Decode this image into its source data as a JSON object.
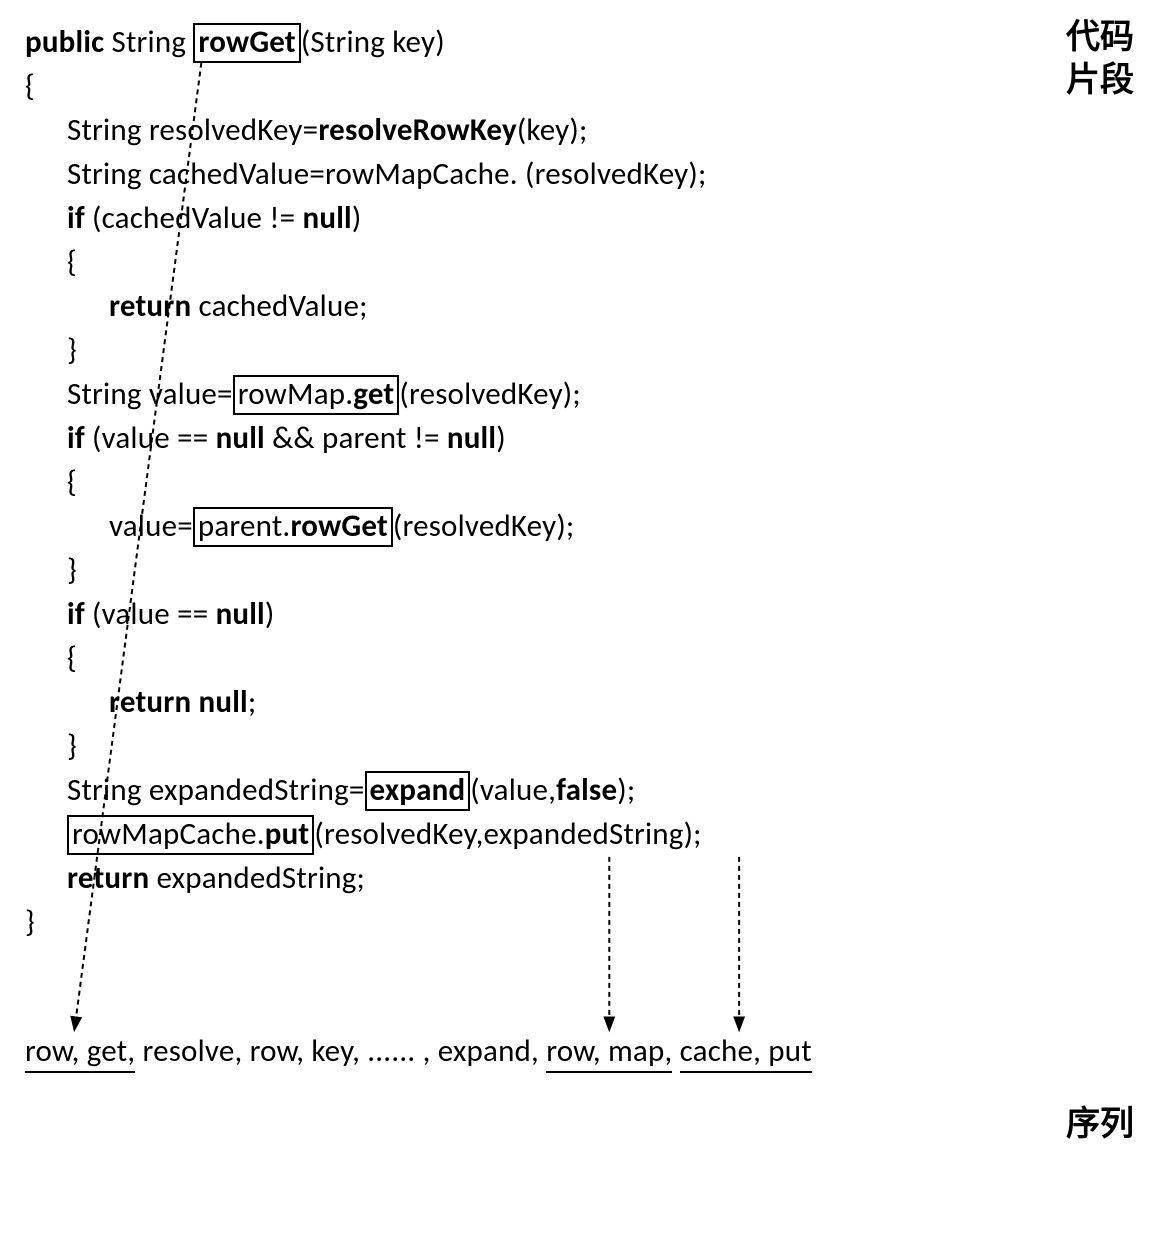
{
  "labels": {
    "code_snippet_line1": "代码",
    "code_snippet_line2": "片段",
    "sequence": "序列"
  },
  "code": {
    "l1_public": "public",
    "l1_string": " String",
    "l1_boxed": "rowGet",
    "l1_rest": "(String key)",
    "l2": "{",
    "l3a": "String resolvedKey=",
    "l3b_bold": "resolveRowKey",
    "l3c": "(key);",
    "l4": "String cachedValue=rowMapCache. (resolvedKey);",
    "l5_if": "if",
    "l5_rest_a": " (cachedValue != ",
    "l5_null": "null",
    "l5_rest_b": ")",
    "l6": "{",
    "l7_return": "return",
    "l7_rest": " cachedValue;",
    "l8": "}",
    "l9a": "String value=",
    "l9_boxed": "rowMap.get",
    "l9c": "(resolvedKey);",
    "l10_if": "if",
    "l10a": " (value == ",
    "l10_null1": "null",
    "l10b": " && parent != ",
    "l10_null2": "null",
    "l10c": ")",
    "l11": "{",
    "l12a": "value=",
    "l12_boxed": "parent.rowGet",
    "l12c": "(resolvedKey);",
    "l13": "}",
    "l14_if": "if",
    "l14a": " (value == ",
    "l14_null": "null",
    "l14b": ")",
    "l15": "{",
    "l16_return": "return",
    "l16_space": " ",
    "l16_null": "null",
    "l16_semi": ";",
    "l17": "}",
    "l18a": "String expandedString=",
    "l18_boxed": "expand",
    "l18c": "(value,",
    "l18_false": "false",
    "l18d": ");",
    "l19_boxed": "rowMapCache.put",
    "l19c": "(resolvedKey,expandedString);",
    "l20_return": "return",
    "l20_rest": " expandedString;",
    "l21": "}"
  },
  "sequence_tokens": {
    "seg1": "row, get,",
    "mid": " resolve, row, key, ...... , expand, ",
    "seg2": "row, map,",
    "gap": " ",
    "seg3": "cache, put"
  },
  "chart_data": {
    "type": "diagram",
    "title": "Code snippet to token sequence extraction",
    "boxed_identifiers": [
      "rowGet",
      "rowMap.get",
      "parent.rowGet",
      "expand",
      "rowMapCache.put"
    ],
    "output_sequence": [
      "row",
      "get",
      "resolve",
      "row",
      "key",
      "......",
      "expand",
      "row",
      "map",
      "cache",
      "put"
    ],
    "arrows": [
      {
        "from": "rowGet (method name)",
        "to": "row, get"
      },
      {
        "from": "expand / rowMapCache.put area",
        "to": "row, map"
      },
      {
        "from": "expand / rowMapCache.put area",
        "to": "cache, put"
      }
    ]
  }
}
